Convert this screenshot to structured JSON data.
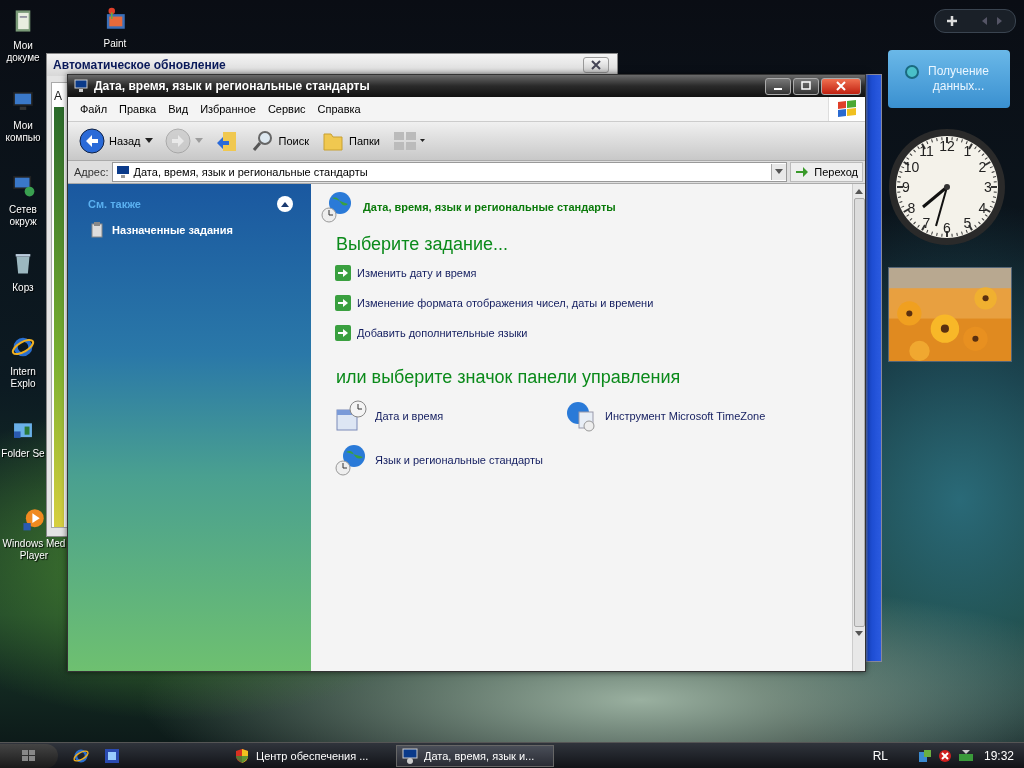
{
  "desktop_icons": [
    {
      "kind": "documents",
      "label_lines": [
        "Мои",
        "докуме"
      ]
    },
    {
      "kind": "paint",
      "label_lines": [
        "Paint"
      ]
    },
    {
      "kind": "computer",
      "label_lines": [
        "Мои",
        "компью"
      ]
    },
    {
      "kind": "network",
      "label_lines": [
        "Сетев",
        "окруж"
      ]
    },
    {
      "kind": "trash",
      "label_lines": [
        "Корз"
      ]
    },
    {
      "kind": "ie",
      "label_lines": [
        "Intern",
        "Explo"
      ]
    },
    {
      "kind": "settings",
      "label_lines": [
        "Folder Se"
      ]
    },
    {
      "kind": "player",
      "label_lines": [
        "Windows Med",
        "Player"
      ]
    }
  ],
  "background_window": {
    "title": "Автоматическое обновление",
    "body_text": "А"
  },
  "window": {
    "title": "Дата, время, язык и региональные стандарты",
    "menu": [
      "Файл",
      "Правка",
      "Вид",
      "Избранное",
      "Сервис",
      "Справка"
    ],
    "toolbar": [
      {
        "kind": "back",
        "label": "Назад",
        "disabled": false
      },
      {
        "kind": "forward",
        "disabled": true
      },
      {
        "kind": "up"
      },
      {
        "kind": "search",
        "label": "Поиск"
      },
      {
        "kind": "folders",
        "label": "Папки"
      },
      {
        "kind": "views"
      }
    ],
    "address": {
      "label": "Адрес:",
      "value": "Дата, время, язык и региональные стандарты",
      "go": "Переход"
    },
    "sidebar": {
      "section_title": "См. также",
      "expanded": true,
      "items": [
        "Назначенные задания"
      ]
    },
    "content": {
      "header": "Дата, время, язык и региональные стандарты",
      "task_heading": "Выберите задание...",
      "tasks": [
        "Изменить дату и время",
        "Изменение формата отображения чисел, даты и времени",
        "Добавить дополнительные языки"
      ],
      "icon_heading": "или выберите значок панели управления",
      "icons": [
        {
          "kind": "datetime",
          "label": "Дата и время"
        },
        {
          "kind": "timezone",
          "label": "Инструмент Microsoft TimeZone"
        },
        {
          "kind": "regional",
          "label": "Язык и региональные стандарты"
        }
      ]
    }
  },
  "gadgets": {
    "weather_text": "Получение данных...",
    "clock_numerals": [
      "12",
      "11",
      "1",
      "10",
      "2",
      "9",
      "3",
      "8",
      "4",
      "7",
      "5",
      "6"
    ]
  },
  "taskbar": {
    "tasks": [
      {
        "kind": "security",
        "label": "Центр обеспечения ...",
        "selected": false
      },
      {
        "kind": "control",
        "label": "Дата, время, язык и...",
        "selected": true
      }
    ],
    "language": "RL",
    "time": "19:32"
  }
}
